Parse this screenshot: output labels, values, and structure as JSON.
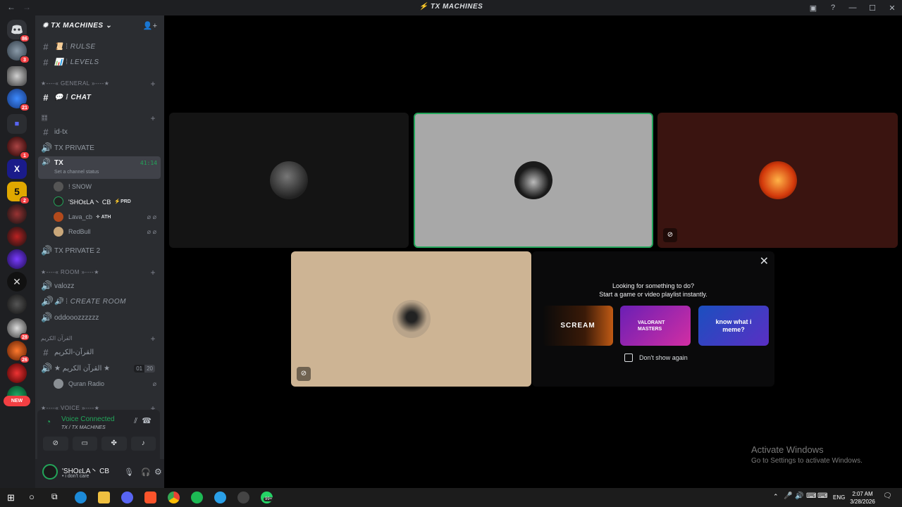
{
  "window": {
    "title": "TX MACHINES",
    "back": "←",
    "forward": "→"
  },
  "servers": {
    "home_badge": "86",
    "badges": [
      "3",
      "21",
      "1",
      "2",
      "28",
      "26"
    ],
    "new_label": "NEW"
  },
  "guild": {
    "name": "TX MACHINES"
  },
  "channels": {
    "rulse": "📜 ⁞ RULSE",
    "levels": "📊 ⁞ LEVELS",
    "cat_general": "★----« GENERAL »----★",
    "chat": "💬 ⁞ CHAT",
    "cat_misc": "🎛",
    "id_tx": "id-tx",
    "tx_private": "TX PRIVATE",
    "tx": "TX",
    "tx_timer": "41:14",
    "tx_status": "Set a channel status",
    "members": [
      {
        "name": "! SNOW",
        "tag": ""
      },
      {
        "name": "'SHOɛLA丶 CB",
        "tag": "⚡PRD"
      },
      {
        "name": "Lava_cb",
        "tag": "✧ ATH"
      },
      {
        "name": "RedBull",
        "tag": ""
      }
    ],
    "tx_private_2": "TX PRIVATE 2",
    "cat_room": "★----« ROOM »----★",
    "valozz": "valozz",
    "create_room": "🔊 ⁞ CREATE ROOM",
    "oddoo": "oddooozzzzzz",
    "cat_quran": "القرآن الكريم",
    "quran_text": "القرآن-الكريم",
    "quran_voice": "★ القرآن الكريم ★",
    "quran_count_a": "01",
    "quran_count_b": "20",
    "quran_radio": "Quran Radio",
    "cat_voice": "★----« VOICE »----★"
  },
  "voice": {
    "status": "Voice Connected",
    "location": "TX / TX MACHINES"
  },
  "user": {
    "name": "'SHOɛLA丶 CB",
    "status": "• i don't care"
  },
  "activity": {
    "line1": "Looking for something to do?",
    "line2": "Start a game or video playlist instantly.",
    "cards": [
      "SCREAM",
      "VALORANT MASTERS",
      "know what i meme?"
    ],
    "dont_show": "Don't show again"
  },
  "watermark": {
    "title": "Activate Windows",
    "subtitle": "Go to Settings to activate Windows."
  },
  "taskbar": {
    "lang": "ENG",
    "time": "2:07 AM",
    "date": "3/28/2026",
    "badge": "99+"
  }
}
